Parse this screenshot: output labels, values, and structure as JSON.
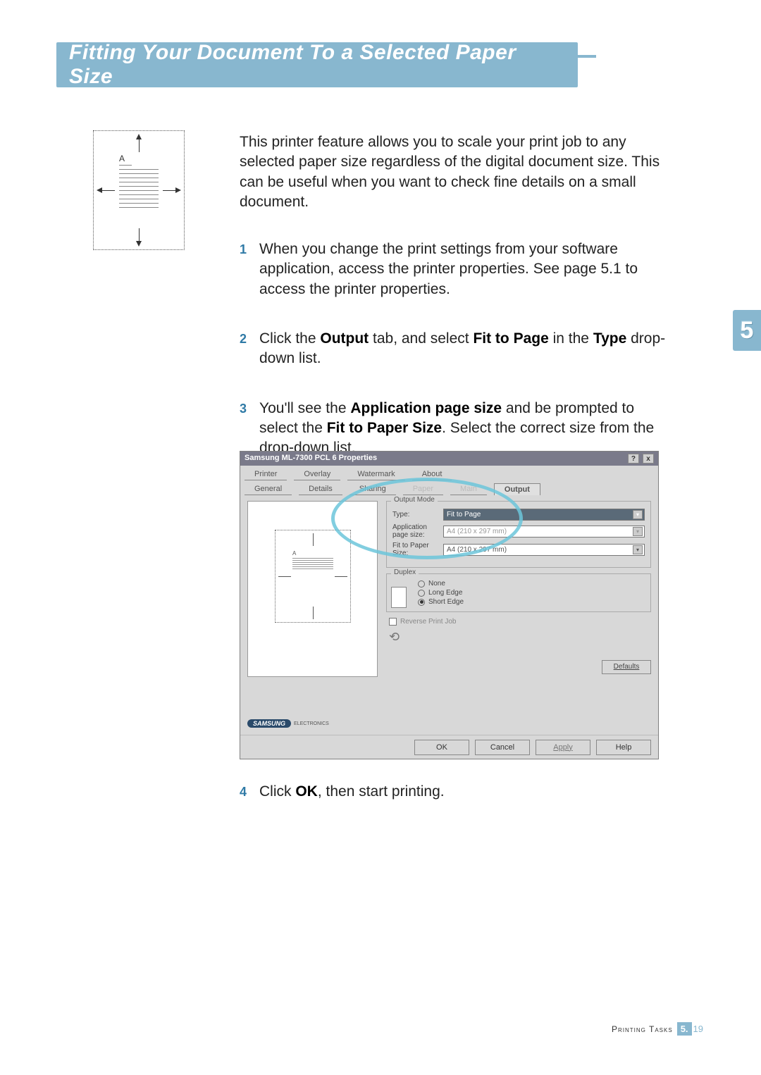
{
  "title": "Fitting Your Document To a Selected Paper Size",
  "chapter_tab": "5",
  "diagram_label": "A",
  "intro": "This printer feature allows you to scale your print job to any selected paper size regardless of the digital document size. This can be useful when you want to check fine details on a small document.",
  "steps": {
    "s1": {
      "num": "1",
      "text": "When you change the print settings from your software application, access the printer properties. See page 5.1 to access the printer properties."
    },
    "s2": {
      "num": "2",
      "pre": "Click the ",
      "b1": "Output",
      "mid1": " tab, and select ",
      "b2": "Fit to Page",
      "mid2": " in the ",
      "b3": "Type",
      "post": " drop-down list."
    },
    "s3": {
      "num": "3",
      "pre": "You'll see the ",
      "b1": "Application page size",
      "mid1": " and be prompted to select the ",
      "b2": "Fit to Paper Size",
      "post": ". Select the correct size from the drop-down list."
    },
    "s4": {
      "num": "4",
      "pre": "Click ",
      "b1": "OK",
      "post": ", then start printing."
    }
  },
  "dialog": {
    "title": "Samsung ML-7300 PCL 6 Properties",
    "title_btn_help": "?",
    "title_btn_close": "x",
    "tabs_row1": [
      "Printer",
      "Overlay",
      "Watermark",
      "About"
    ],
    "tabs_row2": [
      "General",
      "Details",
      "Sharing",
      "Paper",
      "Main",
      "Output"
    ],
    "output_mode": {
      "group": "Output Mode",
      "type_label": "Type:",
      "type_value": "Fit to Page",
      "app_label": "Application page size:",
      "app_value": "A4 (210 x 297 mm)",
      "fit_label": "Fit to Paper Size:",
      "fit_value": "A4 (210 x 297 mm)"
    },
    "duplex": {
      "group": "Duplex",
      "opt_none": "None",
      "opt_long": "Long Edge",
      "opt_short": "Short Edge"
    },
    "reverse": "Reverse Print Job",
    "defaults": "Defaults",
    "logo": "SAMSUNG",
    "logo_sub": "ELECTRONICS",
    "buttons": {
      "ok": "OK",
      "cancel": "Cancel",
      "apply": "Apply",
      "help": "Help"
    }
  },
  "footer": {
    "section": "Printing Tasks",
    "chapter": "5.",
    "page": "19"
  }
}
